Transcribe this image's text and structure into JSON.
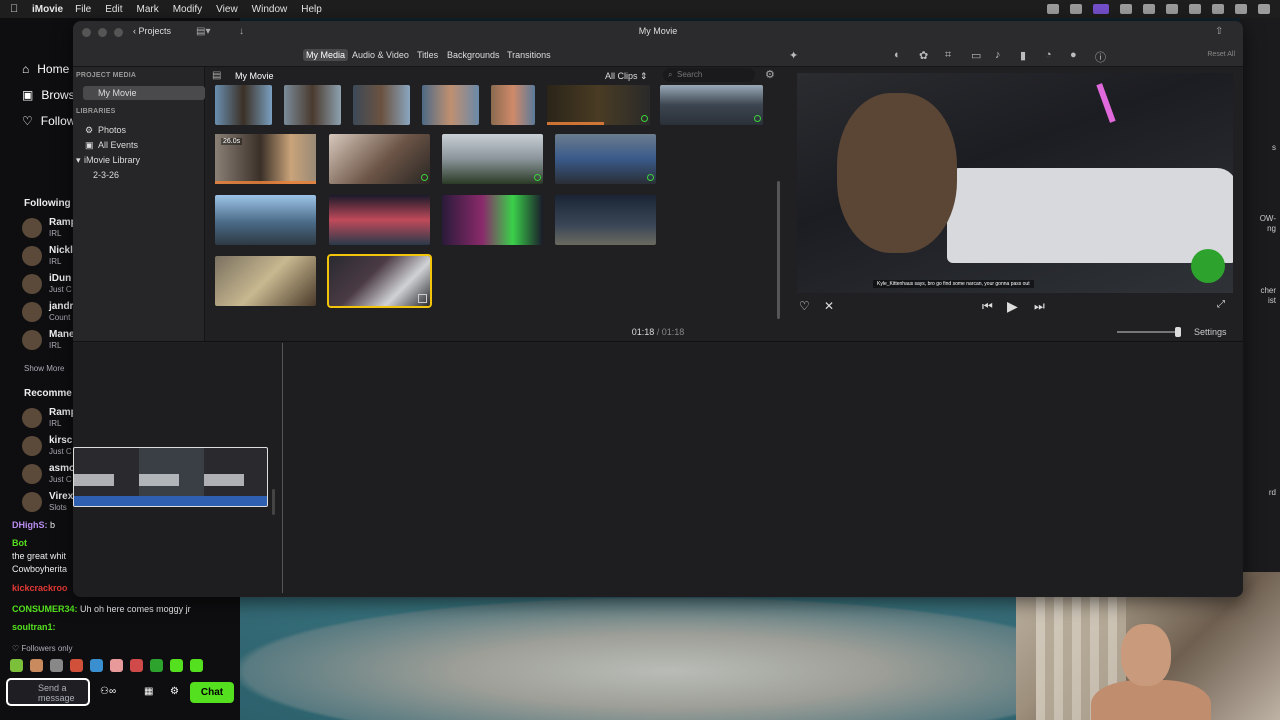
{
  "menubar": {
    "app_name": "iMovie",
    "items": [
      "File",
      "Edit",
      "Mark",
      "Modify",
      "View",
      "Window",
      "Help"
    ]
  },
  "twitch": {
    "nav": [
      "Home",
      "Browse",
      "Following"
    ],
    "following_label": "Following",
    "channels": [
      {
        "name": "Ramp",
        "game": "IRL"
      },
      {
        "name": "Nickl",
        "game": "IRL"
      },
      {
        "name": "iDun",
        "game": "Just C"
      },
      {
        "name": "jandr",
        "game": "Count"
      },
      {
        "name": "Mane",
        "game": "IRL"
      }
    ],
    "show_more": "Show More",
    "recommended_label": "Recomme",
    "recommended": [
      {
        "name": "Ramp",
        "game": "IRL"
      },
      {
        "name": "kirsc",
        "game": "Just C"
      },
      {
        "name": "asmo",
        "game": "Just C"
      },
      {
        "name": "Virex",
        "game": "Slots"
      }
    ],
    "chat": [
      {
        "user": "DHighS:",
        "text": "b",
        "color": "#b98df0"
      },
      {
        "user": "Bot",
        "text": "",
        "color": "#54e01f"
      },
      {
        "user": "",
        "text": "the great whit",
        "color": "#efeff1"
      },
      {
        "user": "",
        "text": "Cowboyherita",
        "color": "#efeff1"
      },
      {
        "user": "kickcrackroo",
        "text": "",
        "color": "#e53935"
      },
      {
        "user": "CONSUMER34:",
        "text": "Uh oh here comes moggy jr",
        "color": "#54e01f"
      },
      {
        "user": "soultran1:",
        "text": "",
        "color": "#54e01f"
      }
    ],
    "followers_only": "Followers only",
    "input_placeholder": "Send a message",
    "chat_button": "Chat"
  },
  "imovie": {
    "window_title": "My Movie",
    "projects_label": "Projects",
    "tabs": [
      "My Media",
      "Audio & Video",
      "Titles",
      "Backgrounds",
      "Transitions"
    ],
    "active_tab": "My Media",
    "reset_all": "Reset All",
    "sidebar": {
      "project_media_header": "PROJECT MEDIA",
      "project_item": "My Movie",
      "libraries_header": "LIBRARIES",
      "photos": "Photos",
      "all_events": "All Events",
      "library": "iMovie Library",
      "event": "2-3-26"
    },
    "browser": {
      "title": "My Movie",
      "filter": "All Clips",
      "search_placeholder": "Search",
      "selected_duration": "26.0s"
    },
    "viewer": {
      "caption": "Kyle_Kittenhaus says, bro go find some narcan, your gonna pass out"
    },
    "timecode": {
      "current": "01:18",
      "separator": "/",
      "total": "01:18"
    },
    "settings_label": "Settings"
  },
  "colors": {
    "accent_selection": "#f2c40a",
    "chat_button": "#54e01f",
    "audio_waveform": "#2f5fb0"
  }
}
